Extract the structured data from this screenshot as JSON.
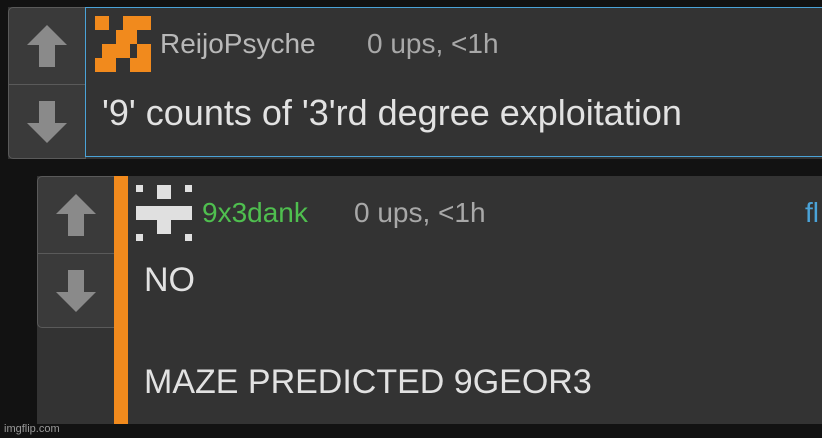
{
  "colors": {
    "background": "#121212",
    "panel": "#333333",
    "op_border": "#4aa3d8",
    "reply_stripe": "#f18a1d",
    "avatar_orange": "#f18a1d",
    "username_op": "#b8b8b8",
    "username_reply": "#4fbf4f",
    "meta": "#a8a8a8",
    "text": "#e2e2e2"
  },
  "comments": [
    {
      "username": "ReijoPsyche",
      "meta": "0 ups, <1h",
      "text": "'9' counts of '3'rd degree exploitation",
      "upvote_icon": "up-arrow-icon",
      "downvote_icon": "down-arrow-icon"
    },
    {
      "username": "9x3dank",
      "meta": "0 ups, <1h",
      "flag": "fl",
      "text_line1": "NO",
      "text_line2": "MAZE PREDICTED 9GEOR3",
      "upvote_icon": "up-arrow-icon",
      "downvote_icon": "down-arrow-icon"
    }
  ],
  "watermark": "imgflip.com"
}
